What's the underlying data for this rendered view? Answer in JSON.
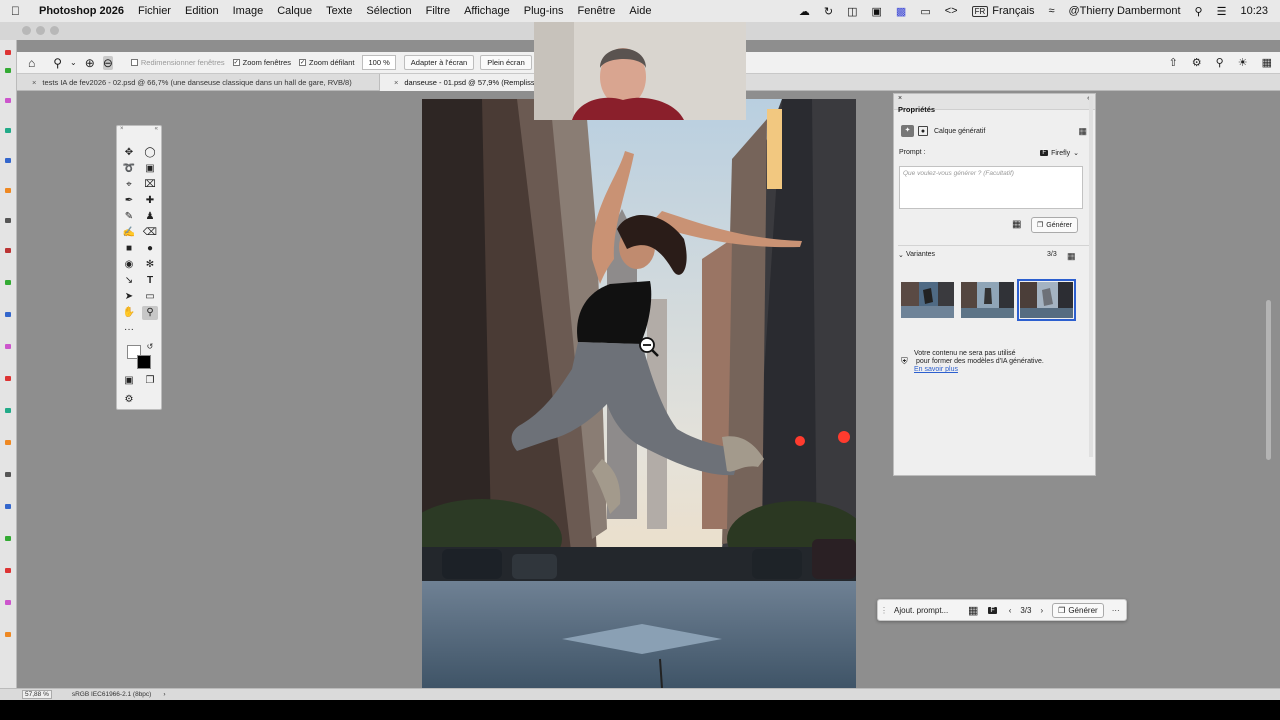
{
  "menubar": {
    "app_name": "Photoshop 2026",
    "items": [
      "Fichier",
      "Edition",
      "Image",
      "Calque",
      "Texte",
      "Sélection",
      "Filtre",
      "Affichage",
      "Plug-ins",
      "Fenêtre",
      "Aide"
    ],
    "language": "Français",
    "language_code": "FR",
    "user": "@Thierry Dambermont",
    "time": "10:23"
  },
  "options_bar": {
    "resize_windows": "Redimensionner fenêtres",
    "zoom_windows": "Zoom fenêtres",
    "scrubby_zoom": "Zoom défilant",
    "zoom_value": "100 %",
    "fit_screen": "Adapter à l'écran",
    "full_screen": "Plein écran"
  },
  "tabs": [
    {
      "label": "tests IA de fev2026 - 02.psd @ 66,7% (une danseuse classique dans un hall de gare, RVB/8)"
    },
    {
      "label": "danseuse - 01.psd @ 57,9% (Remplissage g"
    }
  ],
  "properties": {
    "panel_title": "Propriétés",
    "layer_type": "Calque génératif",
    "prompt_label": "Prompt :",
    "model": "Firefly",
    "prompt_placeholder": "Que voulez-vous générer ?  (Facultatif)",
    "generate": "Générer",
    "variants_label": "Variantes",
    "variants_count": "3/3",
    "notice_line1": "Votre contenu ne sera pas utilisé",
    "notice_line2": "pour former des modèles d'IA générative.",
    "learn_more": "En savoir plus"
  },
  "context_bar": {
    "prompt_placeholder": "Ajout. prompt...",
    "counter": "3/3",
    "generate": "Générer"
  },
  "status": {
    "zoom": "57,88 %",
    "profile": "sRGB IEC61966-2.1 (8bpc)"
  },
  "colors": {
    "accent": "#2c5fcf",
    "canvas_bg": "#8e8e8e",
    "panel_bg": "#efefef"
  }
}
